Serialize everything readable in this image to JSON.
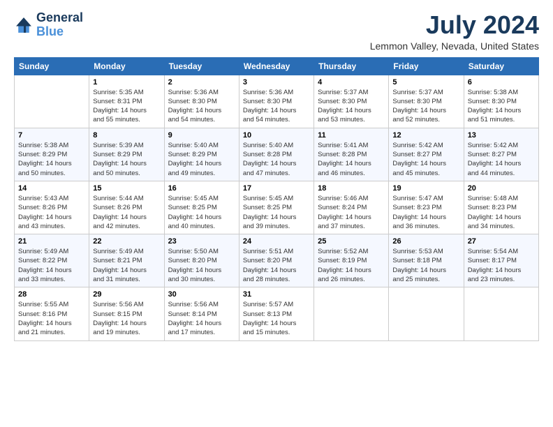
{
  "logo": {
    "line1": "General",
    "line2": "Blue"
  },
  "title": "July 2024",
  "location": "Lemmon Valley, Nevada, United States",
  "days_header": [
    "Sunday",
    "Monday",
    "Tuesday",
    "Wednesday",
    "Thursday",
    "Friday",
    "Saturday"
  ],
  "weeks": [
    [
      {
        "day": "",
        "info": ""
      },
      {
        "day": "1",
        "info": "Sunrise: 5:35 AM\nSunset: 8:31 PM\nDaylight: 14 hours\nand 55 minutes."
      },
      {
        "day": "2",
        "info": "Sunrise: 5:36 AM\nSunset: 8:30 PM\nDaylight: 14 hours\nand 54 minutes."
      },
      {
        "day": "3",
        "info": "Sunrise: 5:36 AM\nSunset: 8:30 PM\nDaylight: 14 hours\nand 54 minutes."
      },
      {
        "day": "4",
        "info": "Sunrise: 5:37 AM\nSunset: 8:30 PM\nDaylight: 14 hours\nand 53 minutes."
      },
      {
        "day": "5",
        "info": "Sunrise: 5:37 AM\nSunset: 8:30 PM\nDaylight: 14 hours\nand 52 minutes."
      },
      {
        "day": "6",
        "info": "Sunrise: 5:38 AM\nSunset: 8:30 PM\nDaylight: 14 hours\nand 51 minutes."
      }
    ],
    [
      {
        "day": "7",
        "info": "Sunrise: 5:38 AM\nSunset: 8:29 PM\nDaylight: 14 hours\nand 50 minutes."
      },
      {
        "day": "8",
        "info": "Sunrise: 5:39 AM\nSunset: 8:29 PM\nDaylight: 14 hours\nand 50 minutes."
      },
      {
        "day": "9",
        "info": "Sunrise: 5:40 AM\nSunset: 8:29 PM\nDaylight: 14 hours\nand 49 minutes."
      },
      {
        "day": "10",
        "info": "Sunrise: 5:40 AM\nSunset: 8:28 PM\nDaylight: 14 hours\nand 47 minutes."
      },
      {
        "day": "11",
        "info": "Sunrise: 5:41 AM\nSunset: 8:28 PM\nDaylight: 14 hours\nand 46 minutes."
      },
      {
        "day": "12",
        "info": "Sunrise: 5:42 AM\nSunset: 8:27 PM\nDaylight: 14 hours\nand 45 minutes."
      },
      {
        "day": "13",
        "info": "Sunrise: 5:42 AM\nSunset: 8:27 PM\nDaylight: 14 hours\nand 44 minutes."
      }
    ],
    [
      {
        "day": "14",
        "info": "Sunrise: 5:43 AM\nSunset: 8:26 PM\nDaylight: 14 hours\nand 43 minutes."
      },
      {
        "day": "15",
        "info": "Sunrise: 5:44 AM\nSunset: 8:26 PM\nDaylight: 14 hours\nand 42 minutes."
      },
      {
        "day": "16",
        "info": "Sunrise: 5:45 AM\nSunset: 8:25 PM\nDaylight: 14 hours\nand 40 minutes."
      },
      {
        "day": "17",
        "info": "Sunrise: 5:45 AM\nSunset: 8:25 PM\nDaylight: 14 hours\nand 39 minutes."
      },
      {
        "day": "18",
        "info": "Sunrise: 5:46 AM\nSunset: 8:24 PM\nDaylight: 14 hours\nand 37 minutes."
      },
      {
        "day": "19",
        "info": "Sunrise: 5:47 AM\nSunset: 8:23 PM\nDaylight: 14 hours\nand 36 minutes."
      },
      {
        "day": "20",
        "info": "Sunrise: 5:48 AM\nSunset: 8:23 PM\nDaylight: 14 hours\nand 34 minutes."
      }
    ],
    [
      {
        "day": "21",
        "info": "Sunrise: 5:49 AM\nSunset: 8:22 PM\nDaylight: 14 hours\nand 33 minutes."
      },
      {
        "day": "22",
        "info": "Sunrise: 5:49 AM\nSunset: 8:21 PM\nDaylight: 14 hours\nand 31 minutes."
      },
      {
        "day": "23",
        "info": "Sunrise: 5:50 AM\nSunset: 8:20 PM\nDaylight: 14 hours\nand 30 minutes."
      },
      {
        "day": "24",
        "info": "Sunrise: 5:51 AM\nSunset: 8:20 PM\nDaylight: 14 hours\nand 28 minutes."
      },
      {
        "day": "25",
        "info": "Sunrise: 5:52 AM\nSunset: 8:19 PM\nDaylight: 14 hours\nand 26 minutes."
      },
      {
        "day": "26",
        "info": "Sunrise: 5:53 AM\nSunset: 8:18 PM\nDaylight: 14 hours\nand 25 minutes."
      },
      {
        "day": "27",
        "info": "Sunrise: 5:54 AM\nSunset: 8:17 PM\nDaylight: 14 hours\nand 23 minutes."
      }
    ],
    [
      {
        "day": "28",
        "info": "Sunrise: 5:55 AM\nSunset: 8:16 PM\nDaylight: 14 hours\nand 21 minutes."
      },
      {
        "day": "29",
        "info": "Sunrise: 5:56 AM\nSunset: 8:15 PM\nDaylight: 14 hours\nand 19 minutes."
      },
      {
        "day": "30",
        "info": "Sunrise: 5:56 AM\nSunset: 8:14 PM\nDaylight: 14 hours\nand 17 minutes."
      },
      {
        "day": "31",
        "info": "Sunrise: 5:57 AM\nSunset: 8:13 PM\nDaylight: 14 hours\nand 15 minutes."
      },
      {
        "day": "",
        "info": ""
      },
      {
        "day": "",
        "info": ""
      },
      {
        "day": "",
        "info": ""
      }
    ]
  ]
}
